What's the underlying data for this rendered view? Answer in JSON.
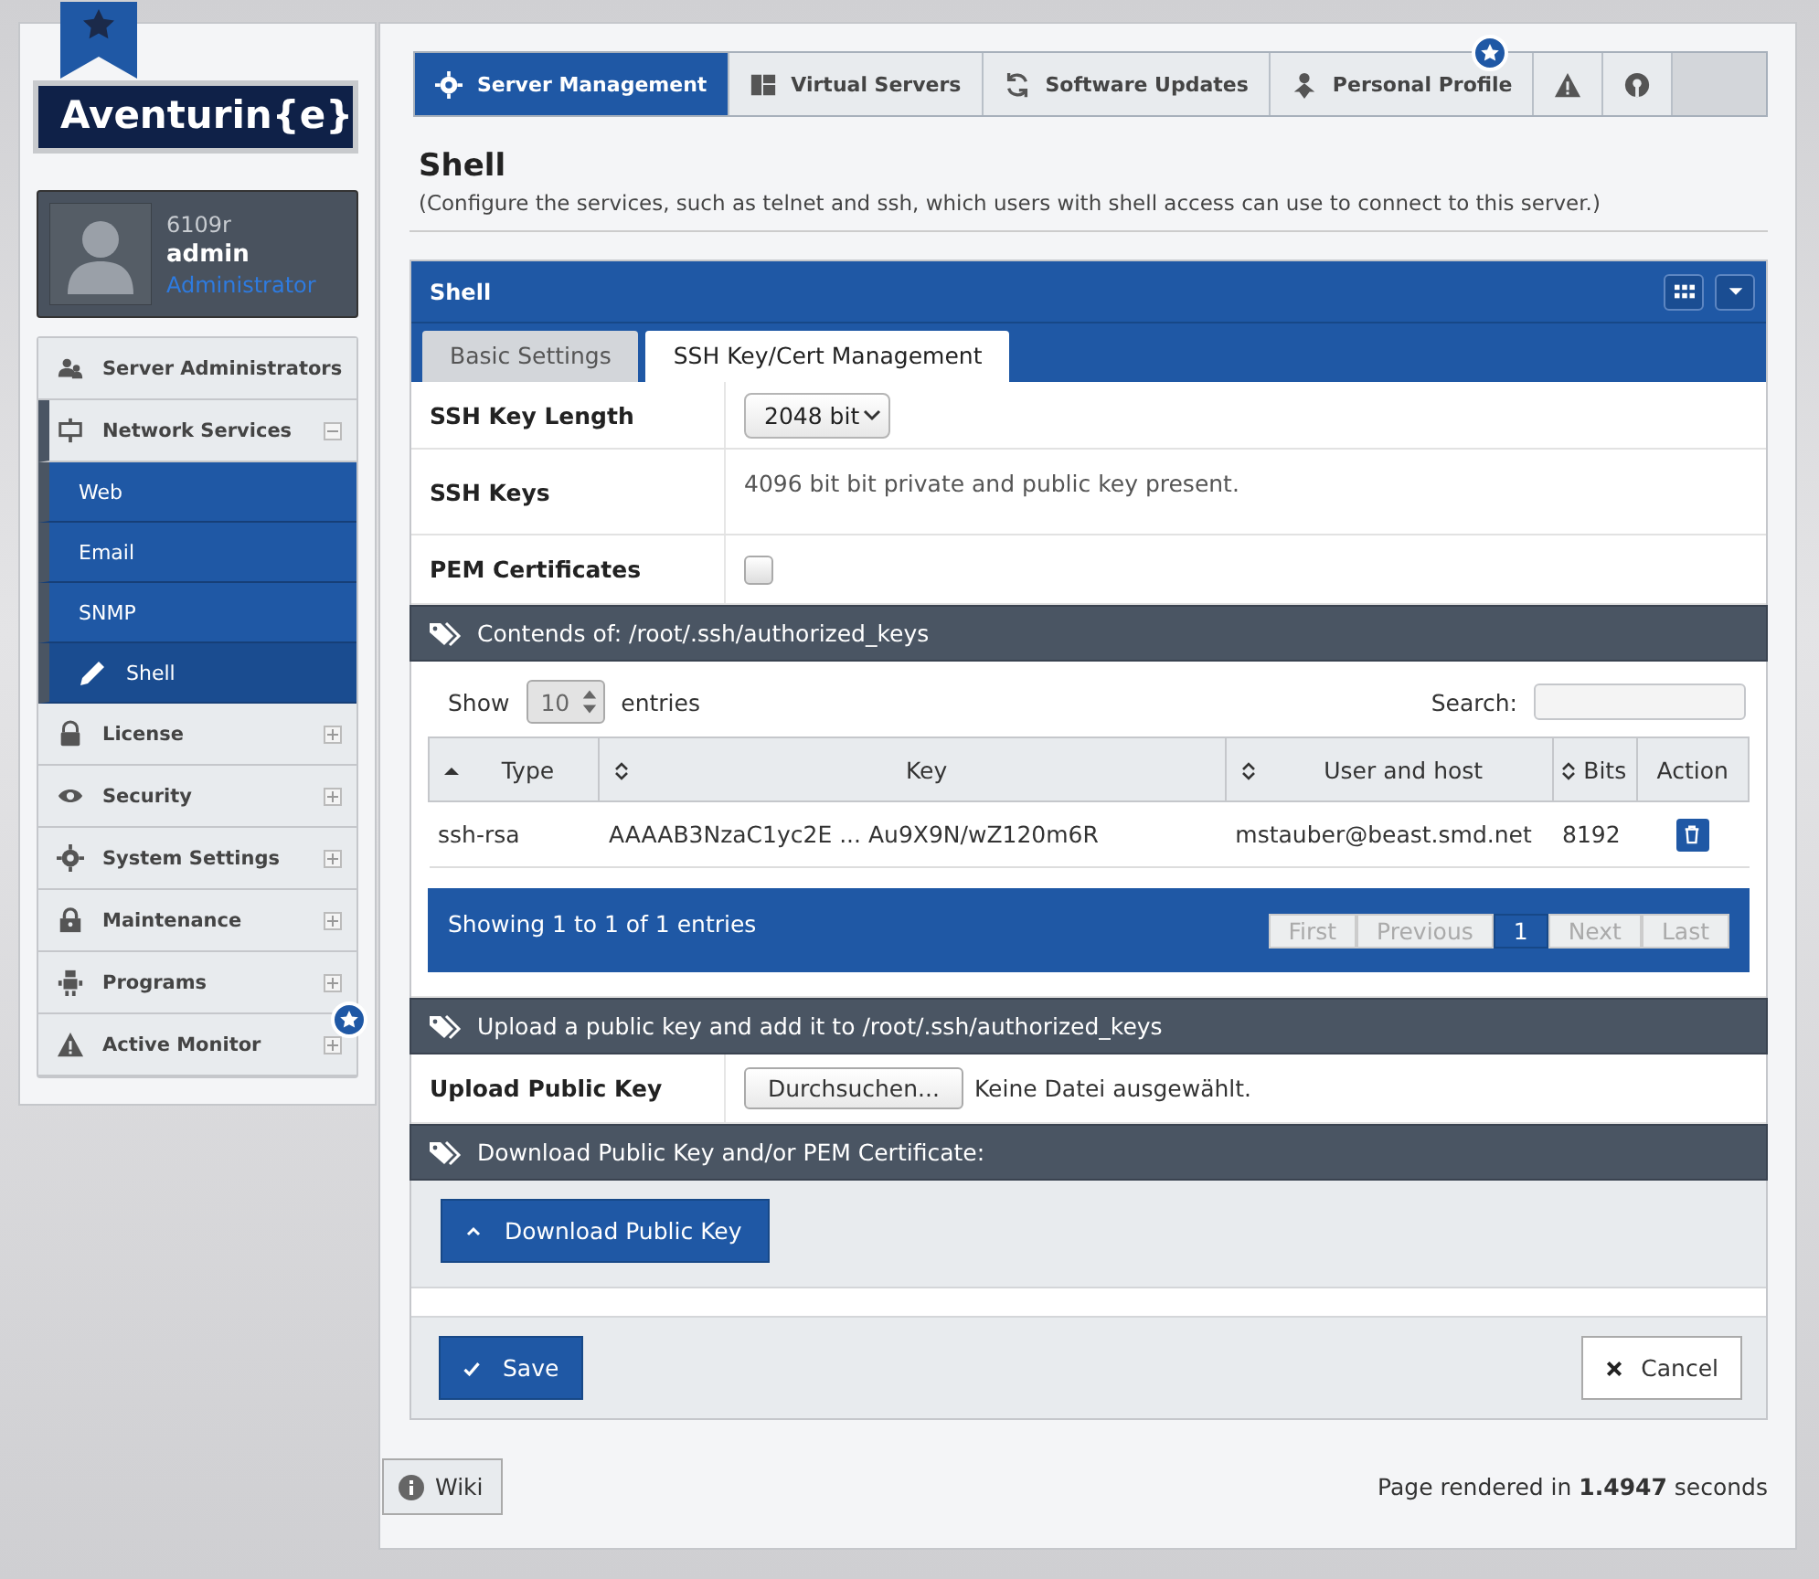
{
  "brand": {
    "logo": "Aventurin{e}"
  },
  "user": {
    "host": "6109r",
    "name": "admin",
    "role": "Administrator"
  },
  "sidebar": {
    "items": [
      {
        "label": "Server Administrators",
        "expanded": false
      },
      {
        "label": "Network Services",
        "expanded": true,
        "children": [
          {
            "label": "Web",
            "selected": false
          },
          {
            "label": "Email",
            "selected": false
          },
          {
            "label": "SNMP",
            "selected": false
          },
          {
            "label": "Shell",
            "selected": true
          }
        ]
      },
      {
        "label": "License",
        "expanded": false
      },
      {
        "label": "Security",
        "expanded": false
      },
      {
        "label": "System Settings",
        "expanded": false
      },
      {
        "label": "Maintenance",
        "expanded": false
      },
      {
        "label": "Programs",
        "expanded": false
      },
      {
        "label": "Active Monitor",
        "expanded": false
      }
    ]
  },
  "top_tabs": [
    {
      "label": "Server Management",
      "selected": true
    },
    {
      "label": "Virtual Servers",
      "selected": false
    },
    {
      "label": "Software Updates",
      "selected": false
    },
    {
      "label": "Personal Profile",
      "selected": false
    },
    {
      "selected": false
    },
    {
      "selected": false
    }
  ],
  "page": {
    "title": "Shell",
    "subtitle": "(Configure the services, such as telnet and ssh, which users with shell access can use to connect to this server.)"
  },
  "panel": {
    "title": "Shell",
    "tabs": [
      {
        "label": "Basic Settings",
        "selected": false
      },
      {
        "label": "SSH Key/Cert Management",
        "selected": true
      }
    ],
    "fields": [
      {
        "label": "SSH Key Length",
        "kind": "select",
        "value": "2048 bit"
      },
      {
        "label": "SSH Keys",
        "kind": "text",
        "value": "4096 bit bit private and public key present."
      },
      {
        "label": "PEM Certificates",
        "kind": "checkbox",
        "checked": false
      }
    ],
    "keys_section": {
      "title": "Contends of: /root/.ssh/authorized_keys",
      "show_label": "Show",
      "page_size": "10",
      "entries_label": "entries",
      "search_label": "Search:",
      "columns": [
        {
          "label": "Type",
          "sorted": true
        },
        {
          "label": "Key",
          "sorted": false
        },
        {
          "label": "User and host",
          "sorted": false
        },
        {
          "label": "Bits",
          "sorted": false
        },
        {
          "label": "Action"
        }
      ],
      "rows": [
        {
          "type": "ssh-rsa",
          "key": "AAAAB3NzaC1yc2E ... Au9X9N/wZ120m6R",
          "user_host": "mstauber@beast.smd.net",
          "bits": "8192"
        }
      ],
      "info": "Showing 1 to 1 of 1 entries",
      "pager": [
        {
          "label": "First",
          "selected": false,
          "disabled": true
        },
        {
          "label": "Previous",
          "selected": false,
          "disabled": true
        },
        {
          "label": "1",
          "selected": true,
          "disabled": false
        },
        {
          "label": "Next",
          "selected": false,
          "disabled": true
        },
        {
          "label": "Last",
          "selected": false,
          "disabled": true
        }
      ]
    },
    "upload_section": {
      "title": "Upload a public key and add it to /root/.ssh/authorized_keys",
      "label": "Upload Public Key",
      "button": "Durchsuchen...",
      "status": "Keine Datei ausgewählt."
    },
    "download_section": {
      "title": "Download Public Key and/or PEM Certificate:",
      "button": "Download Public Key"
    },
    "save": "Save",
    "cancel": "Cancel"
  },
  "footer": {
    "wiki": "Wiki",
    "rendered": "Page rendered in **1.4947** seconds"
  }
}
